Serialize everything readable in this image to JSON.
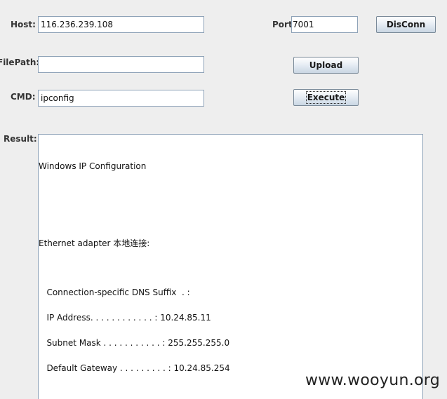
{
  "form": {
    "host_label": "Host:",
    "host_value": "116.236.239.108",
    "port_label": "Port:",
    "port_value": "7001",
    "disconn_label": "DisConn",
    "filepath_label": "FilePath:",
    "filepath_value": "",
    "upload_label": "Upload",
    "cmd_label": "CMD:",
    "cmd_value": "ipconfig",
    "execute_label": "Execute",
    "result_label": "Result:"
  },
  "result": {
    "lines": [
      "Windows IP Configuration",
      "Ethernet adapter 本地连接:",
      "   Connection-specific DNS Suffix  . :",
      "   IP Address. . . . . . . . . . . . : 10.24.85.11",
      "   Subnet Mask . . . . . . . . . . . : 255.255.255.0",
      "   Default Gateway . . . . . . . . . : 10.24.85.254"
    ]
  },
  "watermark": "www.wooyun.org"
}
